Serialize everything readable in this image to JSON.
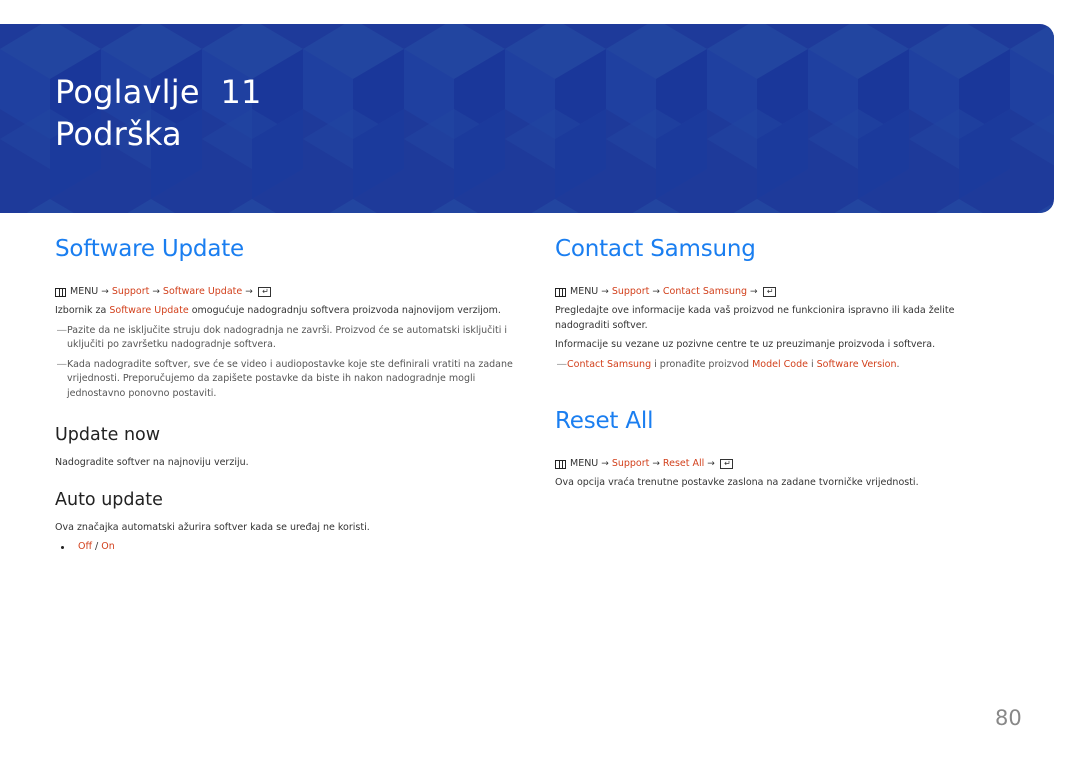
{
  "banner": {
    "chapter_label": "Poglavlje  11",
    "chapter_title": "Podrška"
  },
  "colors": {
    "banner_bg": "#1e3a9a",
    "section_title": "#1a7ef0",
    "accent_link": "#d2401c",
    "page_number": "#888888"
  },
  "left": {
    "software_update": {
      "title": "Software Update",
      "path": {
        "menu_icon": "menu-icon",
        "menu": "MENU",
        "arrow": "→",
        "support": "Support",
        "item": "Software Update",
        "enter_icon": "enter-icon"
      },
      "desc_prefix": "Izbornik za ",
      "desc_link": "Software Update",
      "desc_suffix": " omogućuje nadogradnju softvera proizvoda najnovijom verzijom.",
      "notes": [
        "Pazite da ne isključite struju dok nadogradnja ne završi. Proizvod će se automatski isključiti i uključiti po završetku nadogradnje softvera.",
        "Kada nadogradite softver, sve će se video i audiopostavke koje ste definirali vratiti na zadane vrijednosti. Preporučujemo da zapišete postavke da biste ih nakon nadogradnje mogli jednostavno ponovno postaviti."
      ],
      "note_dash": "―"
    },
    "update_now": {
      "title": "Update now",
      "desc": "Nadogradite softver na najnoviju verziju."
    },
    "auto_update": {
      "title": "Auto update",
      "desc": "Ova značajka automatski ažurira softver kada se uređaj ne koristi.",
      "option_off": "Off",
      "separator": " / ",
      "option_on": "On"
    }
  },
  "right": {
    "contact_samsung": {
      "title": "Contact Samsung",
      "path": {
        "menu": "MENU",
        "arrow": "→",
        "support": "Support",
        "item": "Contact Samsung"
      },
      "desc1": "Pregledajte ove informacije kada vaš proizvod ne funkcionira ispravno ili kada želite nadograditi softver.",
      "desc2": "Informacije su vezane uz pozivne centre te uz preuzimanje proizvoda i softvera.",
      "note": {
        "dash": "―",
        "link1": "Contact Samsung",
        "text1": " i pronađite proizvod ",
        "link2": "Model Code",
        "text2": " i ",
        "link3": "Software Version",
        "text3": "."
      }
    },
    "reset_all": {
      "title": "Reset All",
      "path": {
        "menu": "MENU",
        "arrow": "→",
        "support": "Support",
        "item": "Reset All"
      },
      "desc": "Ova opcija vraća trenutne postavke zaslona na zadane tvorničke vrijednosti."
    }
  },
  "page_number": "80"
}
